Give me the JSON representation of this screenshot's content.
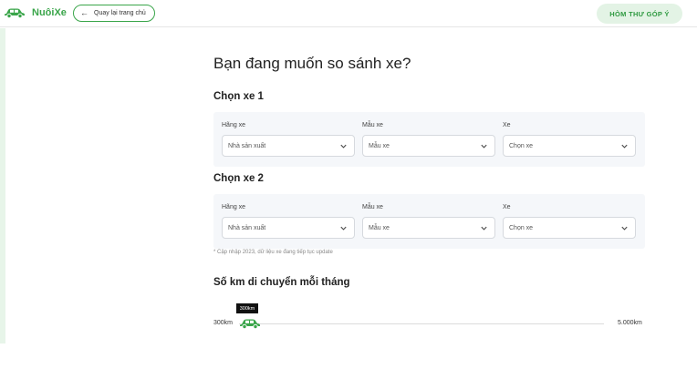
{
  "colors": {
    "brand": "#3aa54a",
    "panel": "#f5f7fa"
  },
  "header": {
    "logo_icon": "car-icon",
    "logo_text": "NuôiXe",
    "back_label": "Quay lại trang chủ",
    "feedback_label": "HÒM THƯ GÓP Ý"
  },
  "main": {
    "title": "Bạn đang muốn so sánh xe?",
    "car1": {
      "heading": "Chọn xe 1",
      "fields": [
        {
          "label": "Hãng xe",
          "placeholder": "Nhà sản xuất"
        },
        {
          "label": "Mẫu xe",
          "placeholder": "Mẫu xe"
        },
        {
          "label": "Xe",
          "placeholder": "Chọn xe"
        }
      ]
    },
    "car2": {
      "heading": "Chọn xe 2",
      "fields": [
        {
          "label": "Hãng xe",
          "placeholder": "Nhà sản xuất"
        },
        {
          "label": "Mẫu xe",
          "placeholder": "Mẫu xe"
        },
        {
          "label": "Xe",
          "placeholder": "Chọn xe"
        }
      ]
    },
    "note": "* Cập nhập 2023, dữ liệu xe đang tiếp tục update",
    "distance": {
      "heading": "Số km di chuyển mỗi tháng",
      "min_label": "300km",
      "max_label": "5.000km",
      "value_label": "300km",
      "value": 300,
      "min": 300,
      "max": 5000,
      "thumb_icon": "car-icon"
    }
  }
}
